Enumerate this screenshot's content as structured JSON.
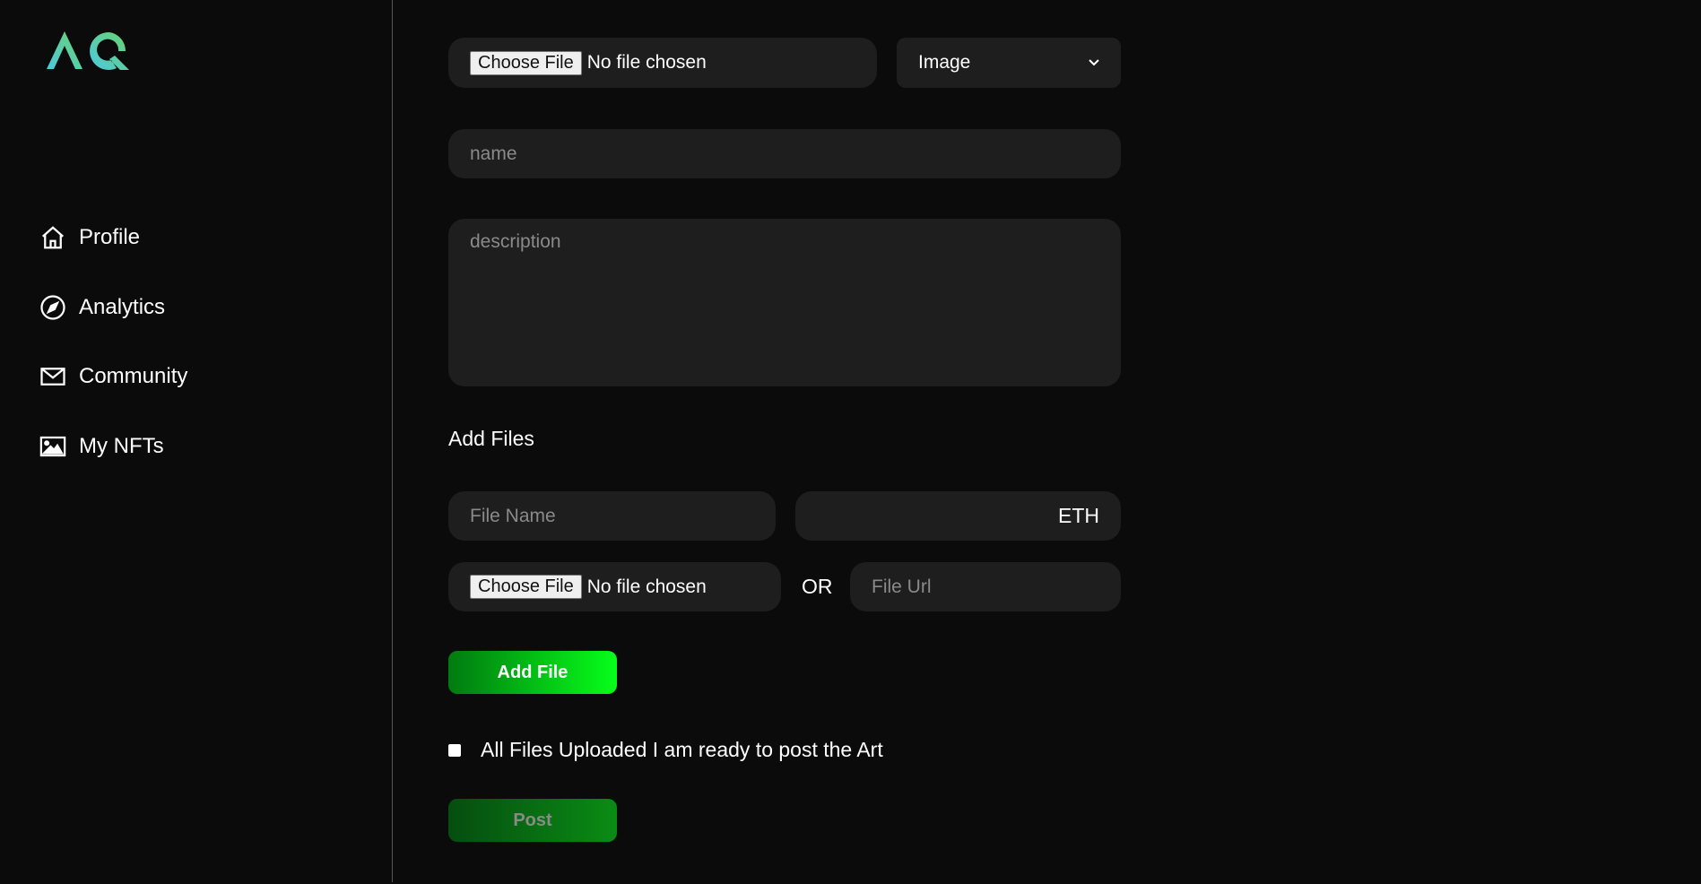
{
  "logo": {
    "text": "AQ",
    "colors": [
      "#4cc9e0",
      "#6ad36a"
    ]
  },
  "sidebar": {
    "items": [
      {
        "label": "Profile",
        "icon": "home-icon"
      },
      {
        "label": "Analytics",
        "icon": "compass-icon"
      },
      {
        "label": "Community",
        "icon": "mail-icon"
      },
      {
        "label": "My NFTs",
        "icon": "image-icon"
      }
    ]
  },
  "form": {
    "file_button": "Choose File",
    "file_status": "No file chosen",
    "type_select": "Image",
    "name_placeholder": "name",
    "description_placeholder": "description",
    "add_files_heading": "Add Files",
    "file_name_placeholder": "File Name",
    "price_suffix": "ETH",
    "file2_button": "Choose File",
    "file2_status": "No file chosen",
    "or_label": "OR",
    "file_url_placeholder": "File Url",
    "add_file_button": "Add File",
    "ready_checkbox_label": "All Files Uploaded I am ready to post the Art",
    "ready_checked": false,
    "post_button": "Post"
  }
}
